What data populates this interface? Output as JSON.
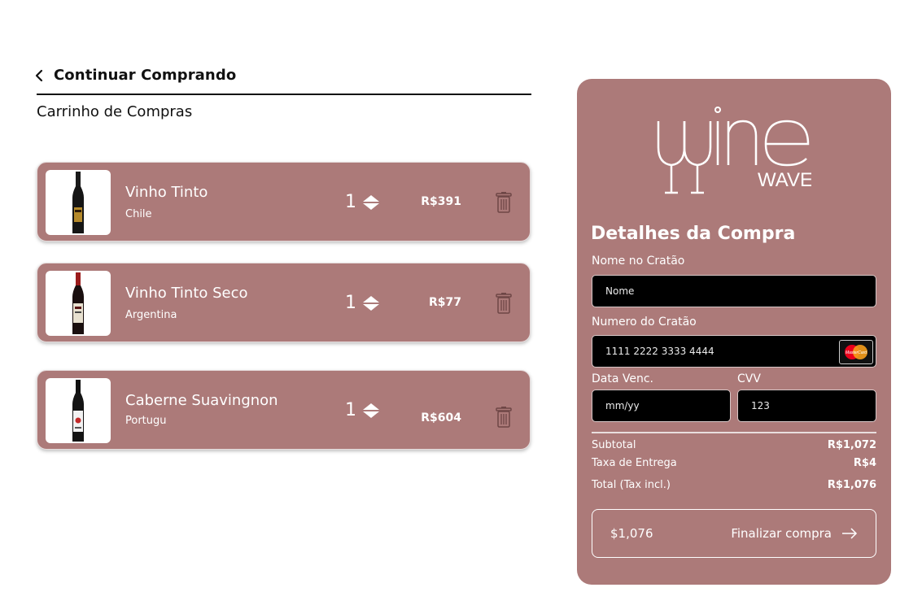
{
  "nav": {
    "back_label": "Continuar Comprando"
  },
  "cart": {
    "title": "Carrinho de Compras",
    "items": [
      {
        "name": "Vinho Tinto",
        "origin": "Chile",
        "qty": "1",
        "price": "R$391"
      },
      {
        "name": "Vinho Tinto Seco",
        "origin": "Argentina",
        "qty": "1",
        "price": "R$77"
      },
      {
        "name": "Caberne Suavingnon",
        "origin": "Portugu",
        "qty": "1",
        "price": "R$604"
      }
    ]
  },
  "brand": {
    "logo_text_main": "wine",
    "logo_text_sub": "WAVE"
  },
  "checkout": {
    "title": "Detalhes da Compra",
    "name_label": "Nome no Cratão",
    "name_placeholder": "Nome",
    "card_label": "Numero do Cratão",
    "card_placeholder": "1111 2222 3333 4444",
    "card_brand": "MasterCard",
    "exp_label": "Data Venc.",
    "exp_placeholder": "mm/yy",
    "cvv_label": "CVV",
    "cvv_placeholder": "123",
    "subtotal_label": "Subtotal",
    "subtotal_value": "R$1,072",
    "shipping_label": "Taxa de Entrega",
    "shipping_value": "R$4",
    "total_label": "Total (Tax incl.)",
    "total_value": "R$1,076",
    "button_amount": "$1,076",
    "button_label": "Finalizar compra"
  },
  "colors": {
    "accent": "#ac7a79",
    "field_bg": "#000000"
  }
}
